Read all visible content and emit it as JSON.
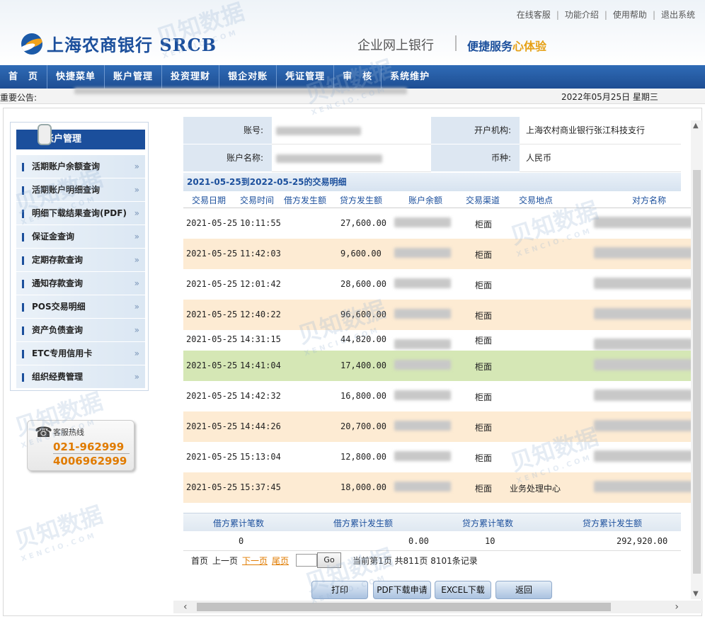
{
  "top_links": [
    "在线客服",
    "功能介绍",
    "使用帮助",
    "退出系统"
  ],
  "top_sep": "|",
  "logo_text": "上海农商银行 SRCB",
  "slogan": "企业网上银行",
  "slogan2_a": "便捷服务",
  "slogan2_b": "心体验",
  "nav": [
    "首　页",
    "快捷菜单",
    "账户管理",
    "投资理财",
    "银企对账",
    "凭证管理",
    "审　核",
    "系统维护"
  ],
  "notice": {
    "label": "重要公告:",
    "date": "2022年05月25日 星期三"
  },
  "sidebar": {
    "title": "账户管理",
    "items": [
      "活期账户余额查询",
      "活期账户明细查询",
      "明细下载结果查询(PDF)",
      "保证金查询",
      "定期存款查询",
      "通知存款查询",
      "POS交易明细",
      "资产负债查询",
      "ETC专用信用卡",
      "组织经费管理"
    ],
    "chevron": "»"
  },
  "hotline": {
    "title": "客服热线",
    "num1": "021-962999",
    "num2": "4006962999"
  },
  "account_info": {
    "account_no_label": "账号:",
    "bank_label": "开户机构:",
    "bank_value": "上海农村商业银行张江科技支行",
    "account_name_label": "账户名称:",
    "currency_label": "币种:",
    "currency_value": "人民币"
  },
  "detail_title": "2021-05-25到2022-05-25的交易明细",
  "columns": [
    "交易日期",
    "交易时间",
    "借方发生额",
    "贷方发生额",
    "账户余额",
    "交易渠道",
    "交易地点",
    "对方名称"
  ],
  "rows": [
    {
      "date": "2021-05-25",
      "time": "10:11:55",
      "credit": "27,600.00",
      "channel": "柜面",
      "place": "",
      "style": "white"
    },
    {
      "date": "2021-05-25",
      "time": "11:42:03",
      "credit": "9,600.00",
      "channel": "柜面",
      "place": "",
      "style": "orange"
    },
    {
      "date": "2021-05-25",
      "time": "12:01:42",
      "credit": "28,600.00",
      "channel": "柜面",
      "place": "",
      "style": "white"
    },
    {
      "date": "2021-05-25",
      "time": "12:40:22",
      "credit": "96,600.00",
      "channel": "柜面",
      "place": "",
      "style": "orange"
    },
    {
      "date": "2021-05-25",
      "time": "14:31:15",
      "credit": "44,820.00",
      "channel": "柜面",
      "place": "",
      "style": "white short"
    },
    {
      "date": "2021-05-25",
      "time": "14:41:04",
      "credit": "17,400.00",
      "channel": "柜面",
      "place": "",
      "style": "green"
    },
    {
      "date": "2021-05-25",
      "time": "14:42:32",
      "credit": "16,800.00",
      "channel": "柜面",
      "place": "",
      "style": "white"
    },
    {
      "date": "2021-05-25",
      "time": "14:44:26",
      "credit": "20,700.00",
      "channel": "柜面",
      "place": "",
      "style": "orange"
    },
    {
      "date": "2021-05-25",
      "time": "15:13:04",
      "credit": "12,800.00",
      "channel": "柜面",
      "place": "",
      "style": "white"
    },
    {
      "date": "2021-05-25",
      "time": "15:37:45",
      "credit": "18,000.00",
      "channel": "柜面",
      "place": "业务处理中心",
      "style": "orange"
    }
  ],
  "summary": {
    "headers": [
      "借方累计笔数",
      "借方累计发生额",
      "贷方累计笔数",
      "贷方累计发生额"
    ],
    "values": [
      "0",
      "0.00",
      "10",
      "292,920.00"
    ]
  },
  "pager": {
    "first": "首页",
    "prev": "上一页",
    "next": "下一页",
    "last": "尾页",
    "go": "Go",
    "status": "当前第1页  共811页  8101条记录"
  },
  "buttons": [
    "打印",
    "PDF下载申请",
    "EXCEL下载",
    "返回"
  ],
  "scroll": {
    "left": "‹",
    "right": "›",
    "up": "▲",
    "down": "▼"
  },
  "watermark": {
    "text": "贝知数据",
    "sub": "XENCIO.COM"
  }
}
